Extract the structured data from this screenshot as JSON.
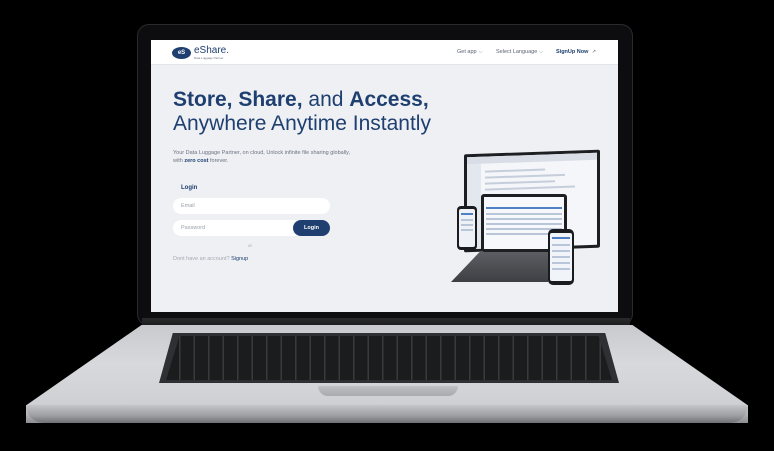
{
  "brand": {
    "logo_mark": "eS",
    "name": "eShare.",
    "tagline": "Data Luggage Partner"
  },
  "nav": {
    "get_app": "Get app",
    "select_language": "Select Language",
    "signup_now": "SignUp Now",
    "chevron": "⌵",
    "arrow": "↗"
  },
  "hero": {
    "line1_a": "Store, Share,",
    "line1_b": " and ",
    "line1_c": "Access,",
    "line2": "Anywhere Anytime Instantly",
    "desc_1": "Your Data Luggage Partner, on cloud, Unlock infinite file sharing globally,",
    "desc_2a": "with ",
    "desc_2b": "zero cost",
    "desc_2c": " forever."
  },
  "login": {
    "title": "Login",
    "email_placeholder": "Email",
    "password_placeholder": "Password",
    "button": "Login",
    "or": "or",
    "no_account": "Dont have an account? ",
    "signup_link": "Signup"
  },
  "colors": {
    "brand_navy": "#1e3f70",
    "page_bg": "#eef0f3"
  },
  "icons": [
    "chevron-down-icon",
    "external-arrow-icon",
    "eshare-logo-icon",
    "devices-illustration"
  ]
}
